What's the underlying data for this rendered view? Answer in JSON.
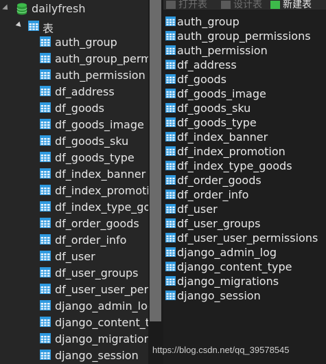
{
  "sidebar": {
    "database": {
      "name": "dailyfresh",
      "icon": "database-icon"
    },
    "category": {
      "label": "表",
      "icon": "table-grid-icon"
    },
    "tables": [
      "auth_group",
      "auth_group_permi",
      "auth_permission",
      "df_address",
      "df_goods",
      "df_goods_image",
      "df_goods_sku",
      "df_goods_type",
      "df_index_banner",
      "df_index_promotio",
      "df_index_type_goo",
      "df_order_goods",
      "df_order_info",
      "df_user",
      "df_user_groups",
      "df_user_user_perm",
      "django_admin_log",
      "django_content_ty",
      "django_migrations",
      "django_session"
    ]
  },
  "toolbar": {
    "open_label": "打开表",
    "design_label": "设计表",
    "new_label": "新建表"
  },
  "objects": {
    "tables": [
      "auth_group",
      "auth_group_permissions",
      "auth_permission",
      "df_address",
      "df_goods",
      "df_goods_image",
      "df_goods_sku",
      "df_goods_type",
      "df_index_banner",
      "df_index_promotion",
      "df_index_type_goods",
      "df_order_goods",
      "df_order_info",
      "df_user",
      "df_user_groups",
      "df_user_user_permissions",
      "django_admin_log",
      "django_content_type",
      "django_migrations",
      "django_session"
    ]
  },
  "watermark": "https://blog.csdn.net/qq_39578545",
  "colors": {
    "accent_green": "#3dbb4a",
    "table_icon_blue": "#2f9ae0",
    "background": "#1e1e1e"
  }
}
